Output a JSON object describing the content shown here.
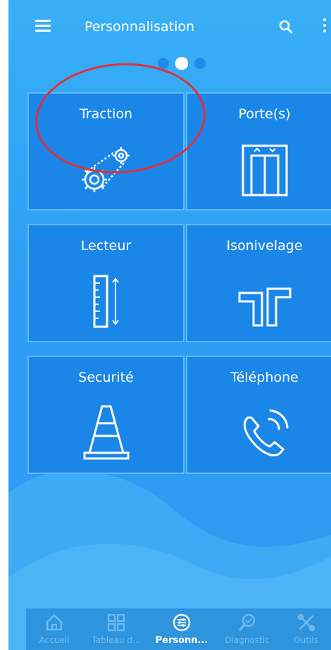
{
  "appbar": {
    "title": "Personnalisation",
    "menu_icon": "hamburger-menu-icon",
    "search_icon": "search-icon",
    "more_icon": "more-vertical-icon"
  },
  "pager": {
    "count": 3,
    "active_index": 1
  },
  "tiles": [
    {
      "label": "Traction",
      "icon": "traction-gear-belt-icon"
    },
    {
      "label": "Porte(s)",
      "icon": "elevator-doors-icon"
    },
    {
      "label": "Lecteur",
      "icon": "ruler-icon"
    },
    {
      "label": "Isonivelage",
      "icon": "leveling-icon"
    },
    {
      "label": "Securité",
      "icon": "traffic-cone-icon"
    },
    {
      "label": "Téléphone",
      "icon": "phone-ringing-icon"
    }
  ],
  "annotation": {
    "color": "#e0303a",
    "target": "Traction"
  },
  "bottom_nav": [
    {
      "label": "Accueil",
      "icon": "home-icon",
      "active": false
    },
    {
      "label": "Tableau d...",
      "icon": "dashboard-grid-icon",
      "active": false
    },
    {
      "label": "Personn...",
      "icon": "customize-sliders-icon",
      "active": true
    },
    {
      "label": "Diagnostic",
      "icon": "diagnostic-search-icon",
      "active": false
    },
    {
      "label": "Outils",
      "icon": "tools-icon",
      "active": false
    }
  ],
  "colors": {
    "background": "#2fa3f4",
    "tile": "#1a86e8",
    "tile_border": "#5fb9f8",
    "nav_active": "#ffffff",
    "nav_inactive": "#6fbcf0"
  }
}
